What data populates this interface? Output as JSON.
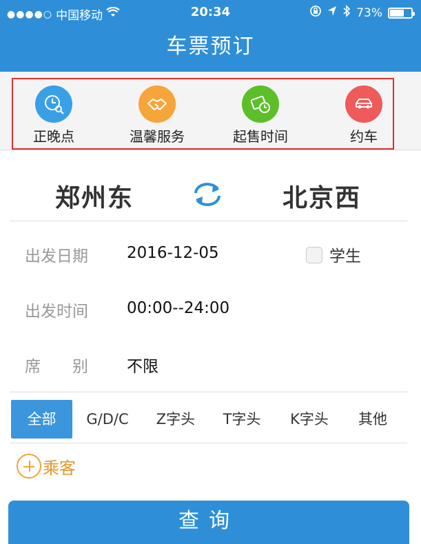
{
  "status_bar": {
    "signal": "●●●●○",
    "carrier": "中国移动",
    "time": "20:34",
    "battery": "73%",
    "battery_level": 0.73
  },
  "header": {
    "title": "车票预订"
  },
  "quick_actions": [
    {
      "label": "正晚点",
      "icon": "clock-search-icon",
      "color": "#3aa0e6"
    },
    {
      "label": "温馨服务",
      "icon": "handshake-icon",
      "color": "#f6a53a"
    },
    {
      "label": "起售时间",
      "icon": "ticket-clock-icon",
      "color": "#5cbf2a"
    },
    {
      "label": "约车",
      "icon": "car-icon",
      "color": "#ef5a5a"
    }
  ],
  "route": {
    "from": "郑州东",
    "to": "北京西"
  },
  "form": {
    "date_label": "出发日期",
    "date_value": "2016-12-05",
    "student_label": "学生",
    "time_label": "出发时间",
    "time_value": "00:00--24:00",
    "seat_label": "席　　别",
    "seat_value": "不限"
  },
  "train_tabs": [
    "全部",
    "G/D/C",
    "Z字头",
    "T字头",
    "K字头",
    "其他"
  ],
  "passenger": {
    "label": "乘客"
  },
  "query_button": {
    "label": "查询"
  }
}
